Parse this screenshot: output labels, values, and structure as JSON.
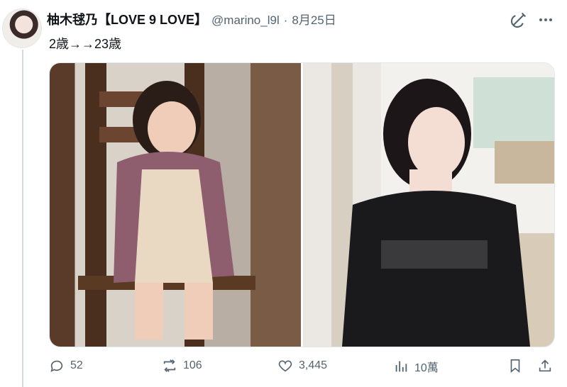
{
  "tweet": {
    "display_name": "柚木毬乃【LOVE 9 LOVE】",
    "handle": "@marino_l9l",
    "separator": "·",
    "date": "8月25日",
    "text": "2歳→→23歳"
  },
  "media": {
    "left_photo": "child-on-wooden-chair",
    "right_photo": "woman-in-black-tshirt"
  },
  "actions": {
    "replies": "52",
    "reposts": "106",
    "likes": "3,445",
    "views": "10萬"
  },
  "icons": {
    "grok": "grok-icon",
    "more": "more-icon",
    "reply": "reply-icon",
    "repost": "repost-icon",
    "like": "heart-icon",
    "views": "views-icon",
    "bookmark": "bookmark-icon",
    "share": "share-icon"
  },
  "colors": {
    "muted": "#536471",
    "text": "#0f1419",
    "line": "#cfd9de"
  }
}
